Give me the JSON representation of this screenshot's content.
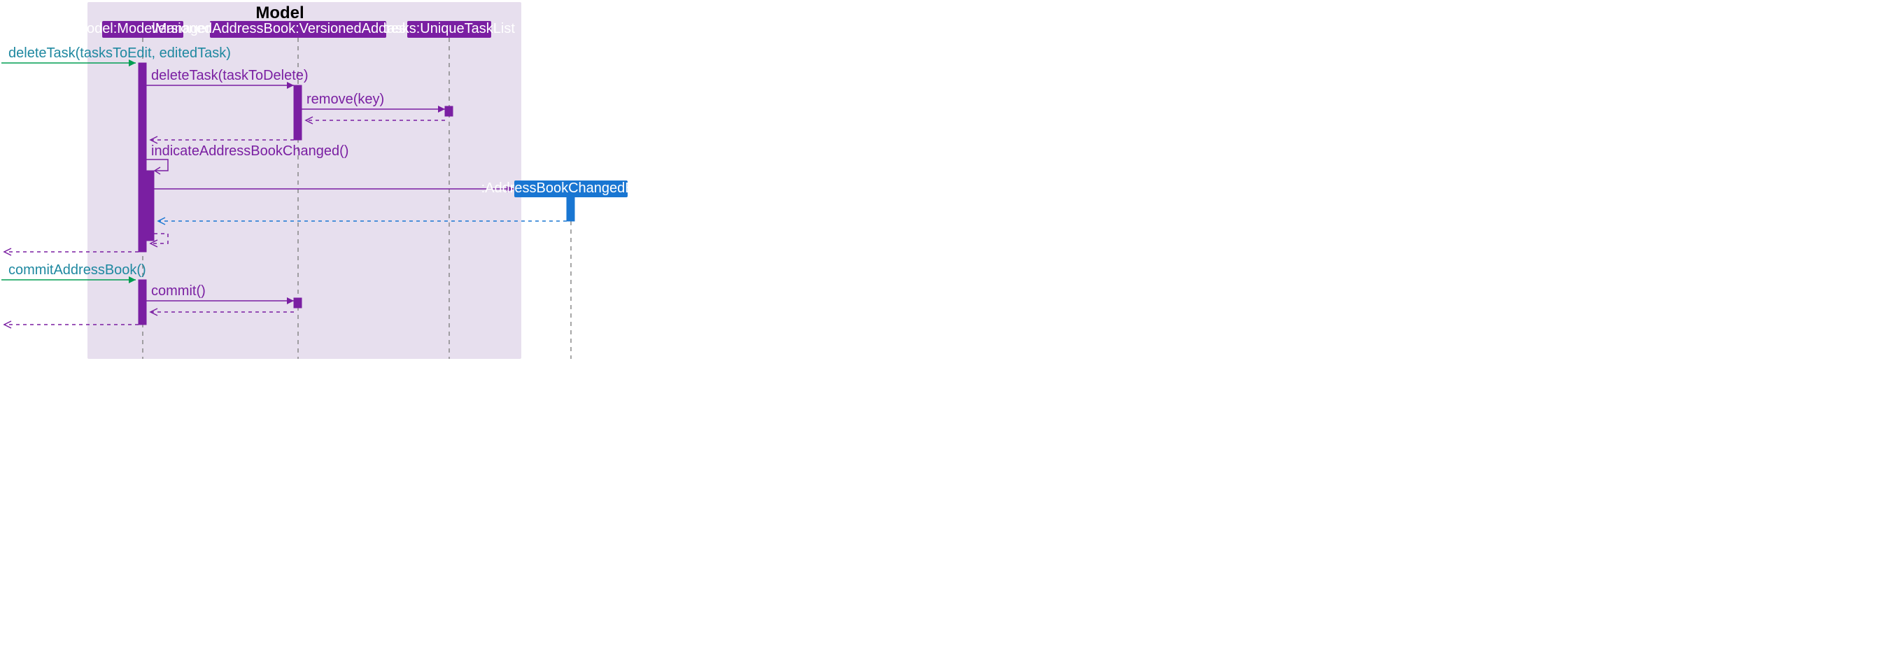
{
  "frame": {
    "title": "Model"
  },
  "participants": {
    "model": "model:ModelManager",
    "vab": "versionedAddressBook:VersionedAddressBook",
    "tasks": "tasks:UniqueTaskList",
    "event": ":AddressBookChangedEvent"
  },
  "messages": {
    "deleteTaskExternal": "deleteTask(tasksToEdit, editedTask)",
    "deleteTaskInternal": "deleteTask(taskToDelete)",
    "remove": "remove(key)",
    "indicate": "indicateAddressBookChanged()",
    "commitAddressBook": "commitAddressBook()",
    "commit": "commit()"
  }
}
